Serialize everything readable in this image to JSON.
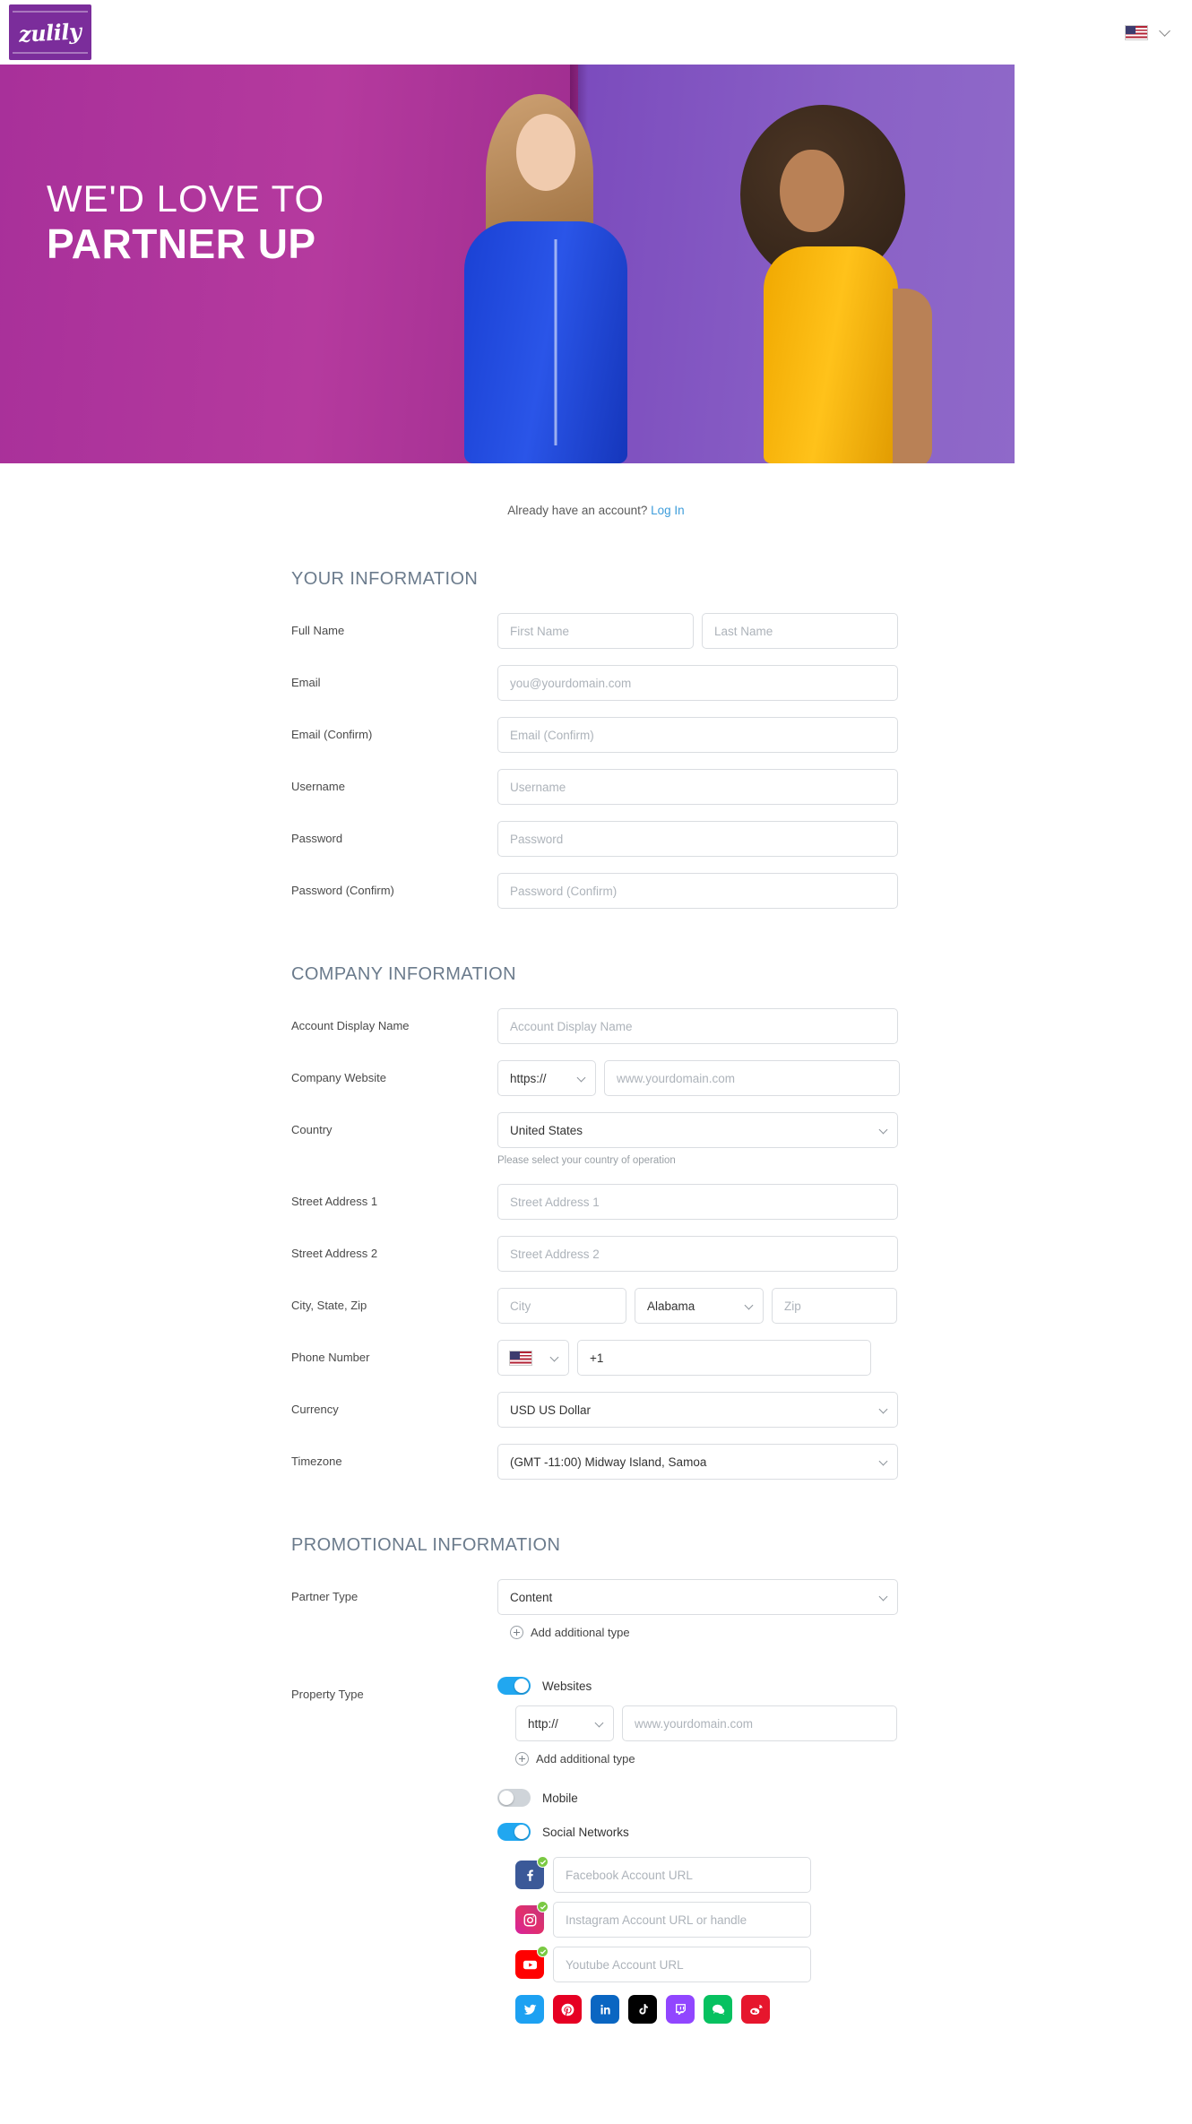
{
  "header": {
    "logo_text": "zulily",
    "locale_flag": "us-flag-icon",
    "locale_chevron": "chevron-down-icon"
  },
  "hero": {
    "line1": "WE'D LOVE TO",
    "line2": "PARTNER UP"
  },
  "account": {
    "prompt": "Already have an account?",
    "login_label": "Log In"
  },
  "sections": {
    "your_information": "YOUR INFORMATION",
    "company_information": "COMPANY INFORMATION",
    "promotional_information": "PROMOTIONAL INFORMATION"
  },
  "your_info": {
    "full_name_label": "Full Name",
    "first_name_placeholder": "First Name",
    "last_name_placeholder": "Last Name",
    "email_label": "Email",
    "email_placeholder": "you@yourdomain.com",
    "email_confirm_label": "Email (Confirm)",
    "email_confirm_placeholder": "Email (Confirm)",
    "username_label": "Username",
    "username_placeholder": "Username",
    "password_label": "Password",
    "password_placeholder": "Password",
    "password_confirm_label": "Password (Confirm)",
    "password_confirm_placeholder": "Password (Confirm)"
  },
  "company_info": {
    "account_display_name_label": "Account Display Name",
    "account_display_name_placeholder": "Account Display Name",
    "company_website_label": "Company Website",
    "website_protocol_value": "https://",
    "website_placeholder": "www.yourdomain.com",
    "country_label": "Country",
    "country_value": "United States",
    "country_help": "Please select your country of operation",
    "street1_label": "Street Address 1",
    "street1_placeholder": "Street Address 1",
    "street2_label": "Street Address 2",
    "street2_placeholder": "Street Address 2",
    "city_state_zip_label": "City, State, Zip",
    "city_placeholder": "City",
    "state_value": "Alabama",
    "zip_placeholder": "Zip",
    "phone_label": "Phone Number",
    "phone_country_flag": "us-flag-icon",
    "phone_value": "+1",
    "currency_label": "Currency",
    "currency_value": "USD US Dollar",
    "timezone_label": "Timezone",
    "timezone_value": "(GMT -11:00) Midway Island, Samoa"
  },
  "promo_info": {
    "partner_type_label": "Partner Type",
    "partner_type_value": "Content",
    "add_additional_type_label": "Add additional type",
    "property_type_label": "Property Type",
    "websites_toggle_label": "Websites",
    "websites_toggle_on": true,
    "website_protocol_value": "http://",
    "website_placeholder": "www.yourdomain.com",
    "add_additional_type_label_2": "Add additional type",
    "mobile_toggle_label": "Mobile",
    "mobile_toggle_on": false,
    "social_toggle_label": "Social Networks",
    "social_toggle_on": true,
    "social_inputs": [
      {
        "network": "facebook",
        "icon": "facebook-icon",
        "placeholder": "Facebook Account URL",
        "verified": true
      },
      {
        "network": "instagram",
        "icon": "instagram-icon",
        "placeholder": "Instagram Account URL or handle",
        "verified": true
      },
      {
        "network": "youtube",
        "icon": "youtube-icon",
        "placeholder": "Youtube Account URL",
        "verified": true
      }
    ],
    "social_icon_choices": [
      {
        "network": "twitter",
        "icon": "twitter-icon",
        "color": "#1da1f2"
      },
      {
        "network": "pinterest",
        "icon": "pinterest-icon",
        "color": "#e60023"
      },
      {
        "network": "linkedin",
        "icon": "linkedin-icon",
        "color": "#0a66c2"
      },
      {
        "network": "tiktok",
        "icon": "tiktok-icon",
        "color": "#010101"
      },
      {
        "network": "twitch",
        "icon": "twitch-icon",
        "color": "#9146ff"
      },
      {
        "network": "wechat",
        "icon": "wechat-icon",
        "color": "#07c160"
      },
      {
        "network": "weibo",
        "icon": "weibo-icon",
        "color": "#e6162d"
      }
    ]
  },
  "colors": {
    "brand_purple": "#7B2D9B",
    "link_blue": "#3e9ddb",
    "toggle_on": "#21a7f0",
    "section_heading": "#6b7b8c"
  }
}
